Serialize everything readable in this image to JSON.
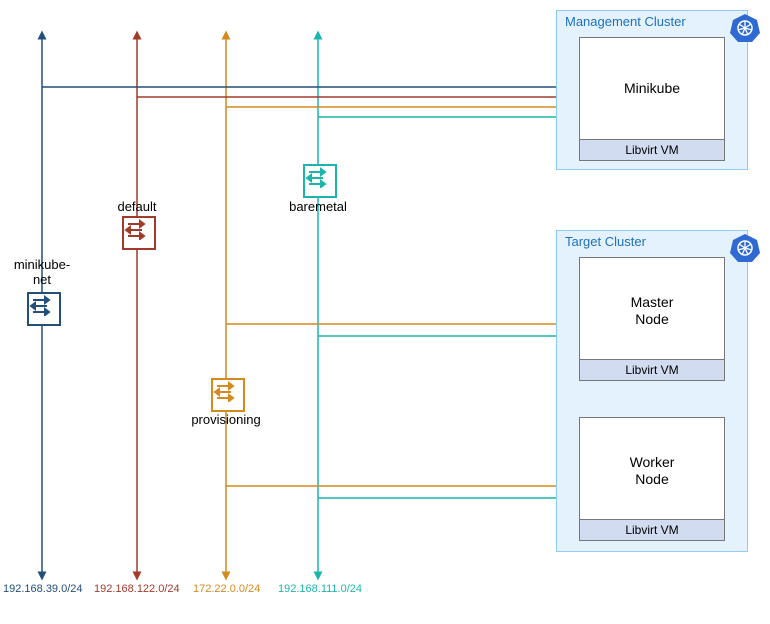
{
  "networks": {
    "minikube_net": {
      "label": "minikube-\nnet",
      "subnet": "192.168.39.0/24",
      "color": "#234f7a"
    },
    "default": {
      "label": "default",
      "subnet": "192.168.122.0/24",
      "color": "#a23a2b"
    },
    "provisioning": {
      "label": "provisioning",
      "subnet": "172.22.0.0/24",
      "color": "#d48a1f"
    },
    "baremetal": {
      "label": "baremetal",
      "subnet": "192.168.111.0/24",
      "color": "#1cb5ac"
    }
  },
  "clusters": {
    "management": {
      "title": "Management Cluster",
      "vms": {
        "minikube": {
          "label": "Minikube",
          "footer": "Libvirt VM"
        }
      }
    },
    "target": {
      "title": "Target Cluster",
      "vms": {
        "master": {
          "label": "Master\nNode",
          "footer": "Libvirt VM"
        },
        "worker": {
          "label": "Worker\nNode",
          "footer": "Libvirt VM"
        }
      }
    }
  }
}
